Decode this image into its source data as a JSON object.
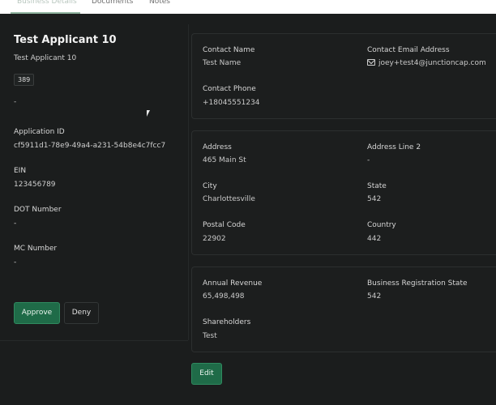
{
  "tabs": [
    {
      "label": "Business Details",
      "active": true
    },
    {
      "label": "Documents",
      "active": false
    },
    {
      "label": "Notes",
      "active": false
    }
  ],
  "applicant": {
    "name": "Test Applicant 10",
    "subtitle": "Test Applicant 10",
    "badge": "389",
    "placeholder": "-",
    "fields": [
      {
        "label": "Application ID",
        "value": "cf5911d1-78e9-49a4-a231-54b8e4c7fcc7"
      },
      {
        "label": "EIN",
        "value": "123456789"
      },
      {
        "label": "DOT Number",
        "value": "-"
      },
      {
        "label": "MC Number",
        "value": "-"
      }
    ],
    "approve_label": "Approve",
    "deny_label": "Deny"
  },
  "contact": {
    "name_label": "Contact Name",
    "name_value": "Test Name",
    "email_label": "Contact Email Address",
    "email_value": "joey+test4@junctioncap.com",
    "phone_label": "Contact Phone",
    "phone_value": "+18045551234"
  },
  "address": {
    "address_label": "Address",
    "address_value": "465 Main St",
    "address2_label": "Address Line 2",
    "address2_value": "-",
    "city_label": "City",
    "city_value": "Charlottesville",
    "state_label": "State",
    "state_value": "542",
    "postal_label": "Postal Code",
    "postal_value": "22902",
    "country_label": "Country",
    "country_value": "442"
  },
  "business": {
    "revenue_label": "Annual Revenue",
    "revenue_value": "65,498,498",
    "reg_state_label": "Business Registration State",
    "reg_state_value": "542",
    "shareholders_label": "Shareholders",
    "shareholders_value": "Test"
  },
  "edit_label": "Edit",
  "colors": {
    "accent": "#1f6b48",
    "background": "#1b1d1d"
  }
}
